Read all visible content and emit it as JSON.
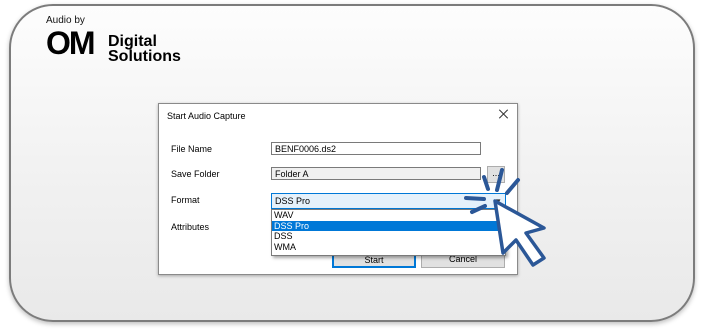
{
  "logo": {
    "tagline": "Audio by",
    "mark": "OM",
    "line1": "Digital",
    "line2": "Solutions"
  },
  "dialog": {
    "title": "Start Audio Capture",
    "file_name_label": "File Name",
    "file_name_value": "BENF0006.ds2",
    "save_folder_label": "Save Folder",
    "save_folder_value": "Folder A",
    "browse_label": "...",
    "format_label": "Format",
    "format_value": "DSS Pro",
    "attributes_label": "Attributes",
    "format_options": [
      "WAV",
      "DSS Pro",
      "DSS",
      "WMA"
    ],
    "selected_option": "DSS Pro",
    "start_label": "Start",
    "cancel_label": "Cancel"
  },
  "colors": {
    "accent": "#0078d7",
    "cursor_fill": "#2b5797"
  }
}
